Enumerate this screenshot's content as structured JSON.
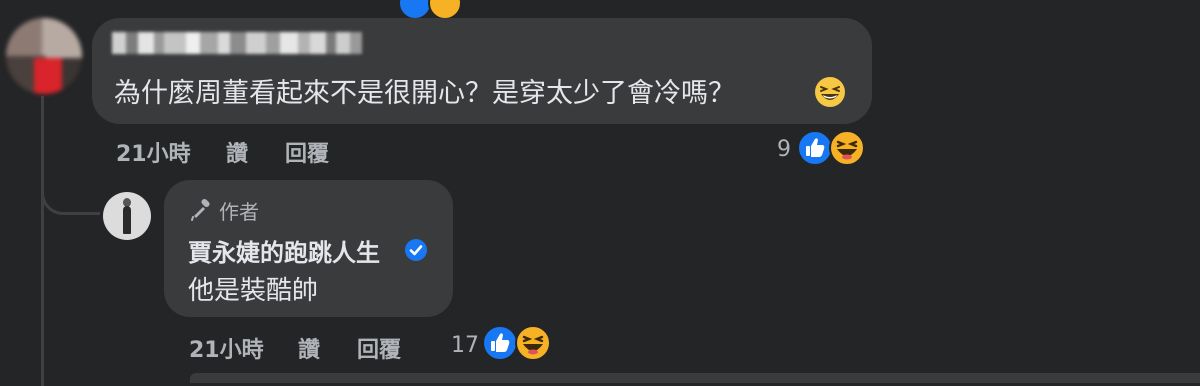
{
  "comment": {
    "text": "為什麼周董看起來不是很開心？是穿太少了會冷嗎？",
    "emoji": "grinning-squinting-face",
    "time": "21小時",
    "like_label": "讚",
    "reply_label": "回覆",
    "reaction_count": "9",
    "reactions": [
      "like",
      "haha"
    ]
  },
  "reply": {
    "badge": "作者",
    "author": "賈永婕的跑跳人生",
    "verified": true,
    "text": "他是裝酷帥",
    "time": "21小時",
    "like_label": "讚",
    "reply_label": "回覆",
    "reaction_count": "17",
    "reactions": [
      "like",
      "haha"
    ]
  },
  "colors": {
    "background": "#242526",
    "bubble": "#3a3b3c",
    "text": "#e4e6eb",
    "secondary": "#b0b3b8",
    "like_blue": "#1877f2",
    "haha_yellow": "#f7b125"
  }
}
